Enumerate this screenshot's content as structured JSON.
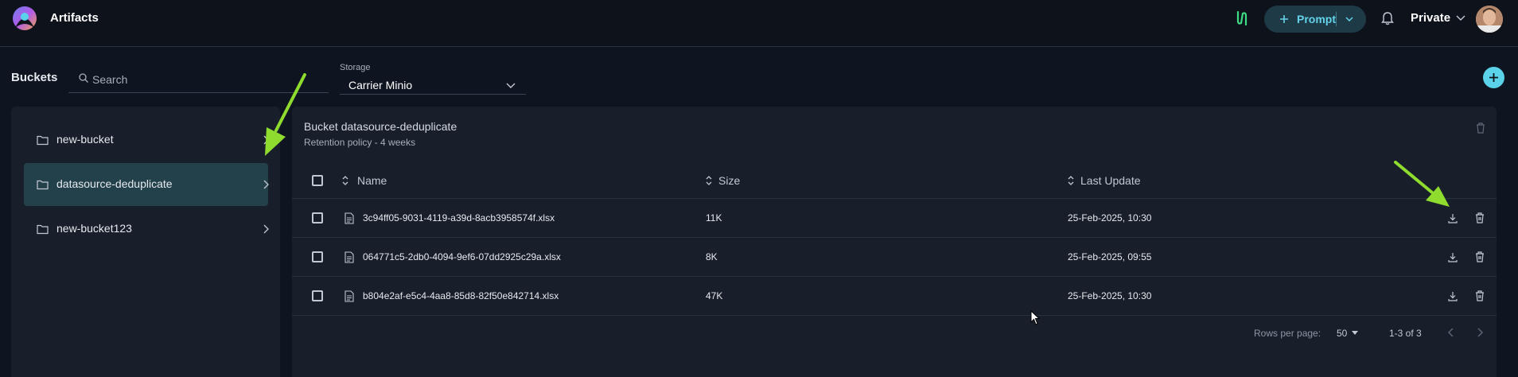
{
  "app": {
    "title": "Artifacts"
  },
  "header": {
    "prompt_label": "Prompt",
    "project_label": "Private",
    "accent_color": "#5ad3ea",
    "icons": [
      "app-logo-icon",
      "flow-icon",
      "plus-icon",
      "chevron-down-icon",
      "bell-icon",
      "avatar"
    ]
  },
  "buckets": {
    "label": "Buckets",
    "search_placeholder": "Search",
    "items": [
      {
        "name": "new-bucket",
        "selected": false
      },
      {
        "name": "datasource-deduplicate",
        "selected": true
      },
      {
        "name": "new-bucket123",
        "selected": false
      }
    ]
  },
  "storage": {
    "caption": "Storage",
    "value": "Carrier Minio"
  },
  "bucket_detail": {
    "title": "Bucket datasource-deduplicate",
    "retention": "Retention policy - 4 weeks",
    "columns": {
      "name": "Name",
      "size": "Size",
      "last_update": "Last Update"
    },
    "files": [
      {
        "name": "3c94ff05-9031-4119-a39d-8acb3958574f.xlsx",
        "size": "11K",
        "last_update": "25-Feb-2025, 10:30"
      },
      {
        "name": "064771c5-2db0-4094-9ef6-07dd2925c29a.xlsx",
        "size": "8K",
        "last_update": "25-Feb-2025, 09:55"
      },
      {
        "name": "b804e2af-e5c4-4aa8-85d8-82f50e842714.xlsx",
        "size": "47K",
        "last_update": "25-Feb-2025, 10:30"
      }
    ],
    "pagination": {
      "rows_per_page_label": "Rows per page:",
      "rows_per_page": "50",
      "range": "1-3 of 3"
    }
  }
}
